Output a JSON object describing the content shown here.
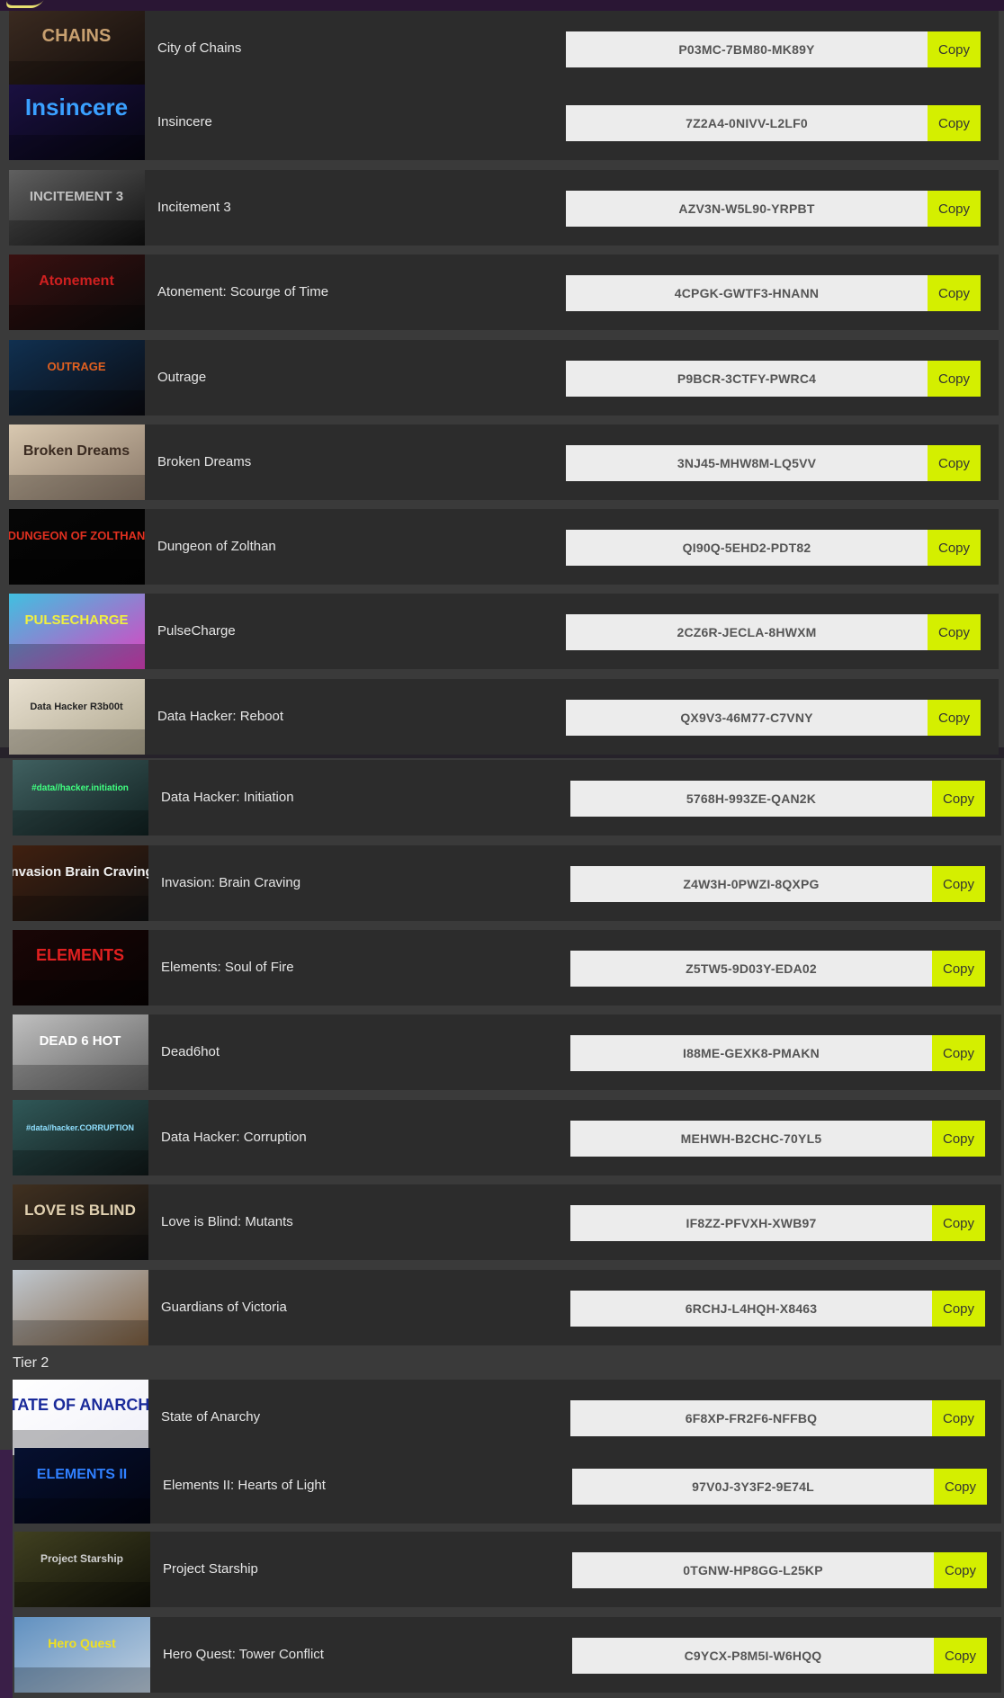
{
  "tier_label": "Tier 2",
  "copy_label": "Copy",
  "accent_color": "#d4ef00",
  "games": [
    {
      "title": "City of Chains",
      "key": "P03MC-7BM80-MK89Y",
      "thumb_text": "CHAINS"
    },
    {
      "title": "Insincere",
      "key": "7Z2A4-0NIVV-L2LF0",
      "thumb_text": "Insincere"
    },
    {
      "title": "Incitement 3",
      "key": "AZV3N-W5L90-YRPBT",
      "thumb_text": "INCITEMENT 3"
    },
    {
      "title": "Atonement: Scourge of Time",
      "key": "4CPGK-GWTF3-HNANN",
      "thumb_text": "Atonement"
    },
    {
      "title": "Outrage",
      "key": "P9BCR-3CTFY-PWRC4",
      "thumb_text": "OUTRAGE"
    },
    {
      "title": "Broken Dreams",
      "key": "3NJ45-MHW8M-LQ5VV",
      "thumb_text": "Broken Dreams"
    },
    {
      "title": "Dungeon of Zolthan",
      "key": "QI90Q-5EHD2-PDT82",
      "thumb_text": "DUNGEON OF ZOLTHAN"
    },
    {
      "title": "PulseCharge",
      "key": "2CZ6R-JECLA-8HWXM",
      "thumb_text": "PULSECHARGE"
    },
    {
      "title": "Data Hacker: Reboot",
      "key": "QX9V3-46M77-C7VNY",
      "thumb_text": "Data Hacker R3b00t"
    },
    {
      "title": "Data Hacker: Initiation",
      "key": "5768H-993ZE-QAN2K",
      "thumb_text": "#data//hacker.initiation"
    },
    {
      "title": "Invasion: Brain Craving",
      "key": "Z4W3H-0PWZI-8QXPG",
      "thumb_text": "Invasion Brain Craving"
    },
    {
      "title": "Elements: Soul of Fire",
      "key": "Z5TW5-9D03Y-EDA02",
      "thumb_text": "ELEMENTS"
    },
    {
      "title": "Dead6hot",
      "key": "I88ME-GEXK8-PMAKN",
      "thumb_text": "DEAD 6 HOT"
    },
    {
      "title": "Data Hacker: Corruption",
      "key": "MEHWH-B2CHC-70YL5",
      "thumb_text": "#data//hacker.CORRUPTION"
    },
    {
      "title": "Love is Blind: Mutants",
      "key": "IF8ZZ-PFVXH-XWB97",
      "thumb_text": "LOVE IS BLIND"
    },
    {
      "title": "Guardians of Victoria",
      "key": "6RCHJ-L4HQH-X8463",
      "thumb_text": ""
    },
    {
      "title": "State of Anarchy",
      "key": "6F8XP-FR2F6-NFFBQ",
      "thumb_text": "$TATE OF ANARCHY"
    },
    {
      "title": "Elements II: Hearts of Light",
      "key": "97V0J-3Y3F2-9E74L",
      "thumb_text": "ELEMENTS II"
    },
    {
      "title": "Project Starship",
      "key": "0TGNW-HP8GG-L25KP",
      "thumb_text": "Project Starship"
    },
    {
      "title": "Hero Quest: Tower Conflict",
      "key": "C9YCX-P8M5I-W6HQQ",
      "thumb_text": "Hero Quest"
    }
  ]
}
